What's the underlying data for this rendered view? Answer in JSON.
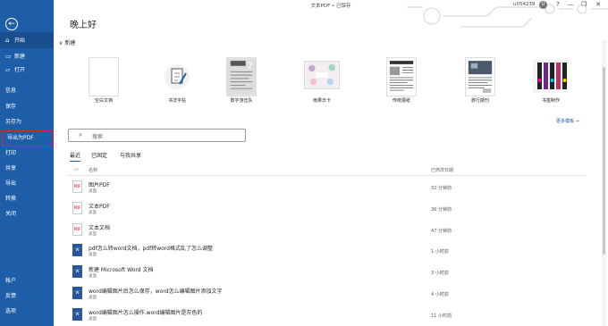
{
  "window": {
    "doc_title": "文本PDF • 已保存",
    "user": "u054239",
    "avatar_text": "U",
    "buttons": [
      "?",
      "—",
      "❐",
      "✕"
    ]
  },
  "sidebar": {
    "back_icon": "←",
    "top_items": [
      {
        "label": "开始",
        "icon": "⌂"
      },
      {
        "label": "新建",
        "icon": "▭"
      },
      {
        "label": "打开",
        "icon": "▱"
      }
    ],
    "items": [
      "信息",
      "保存",
      "另存为",
      "导出为PDF",
      "打印",
      "共享",
      "导出",
      "转换",
      "关闭"
    ],
    "bottom": [
      "帐户",
      "反馈",
      "选项"
    ]
  },
  "greeting": "晚上好",
  "new_section": {
    "chevron": "∨",
    "label": "新建"
  },
  "templates": [
    {
      "label": "空白文档"
    },
    {
      "label": "书法字帖"
    },
    {
      "label": "数字游击队"
    },
    {
      "label": "雨果日卡"
    },
    {
      "label": "传统报纸"
    },
    {
      "label": "旅行期刊"
    },
    {
      "label": "书签制作"
    }
  ],
  "more_templates": "更多模板 →",
  "search": {
    "icon": "⌕",
    "placeholder": "搜索"
  },
  "tabs": [
    "最近",
    "已固定",
    "与我共享"
  ],
  "list": {
    "col_name": "名称",
    "col_date": "已修改日期",
    "rows": [
      {
        "name": "图片PDF",
        "location": "桌面",
        "date": "32 分钟前",
        "type": "pdf"
      },
      {
        "name": "文本PDF",
        "location": "桌面",
        "date": "36 分钟前",
        "type": "pdf"
      },
      {
        "name": "文本文档",
        "location": "桌面",
        "date": "47 分钟前",
        "type": "pdf"
      },
      {
        "name": "pdf怎么转word文档，pdf转word格式乱了怎么调整",
        "location": "桌面",
        "date": "1 小时前",
        "type": "word"
      },
      {
        "name": "新建 Microsoft Word 文档",
        "location": "桌面",
        "date": "3 小时前",
        "type": "word"
      },
      {
        "name": "word编辑图片后怎么保存，word怎么编辑图片添加文字",
        "location": "桌面",
        "date": "4 小时前",
        "type": "word"
      },
      {
        "name": "word编辑图片怎么操作,word编辑图片是灰色的",
        "location": "桌面",
        "date": "11 小时前",
        "type": "word"
      }
    ]
  },
  "colors": {
    "sidebar": "#1e5da8",
    "highlight": "#e0202a",
    "accent": "#1e5da8"
  }
}
